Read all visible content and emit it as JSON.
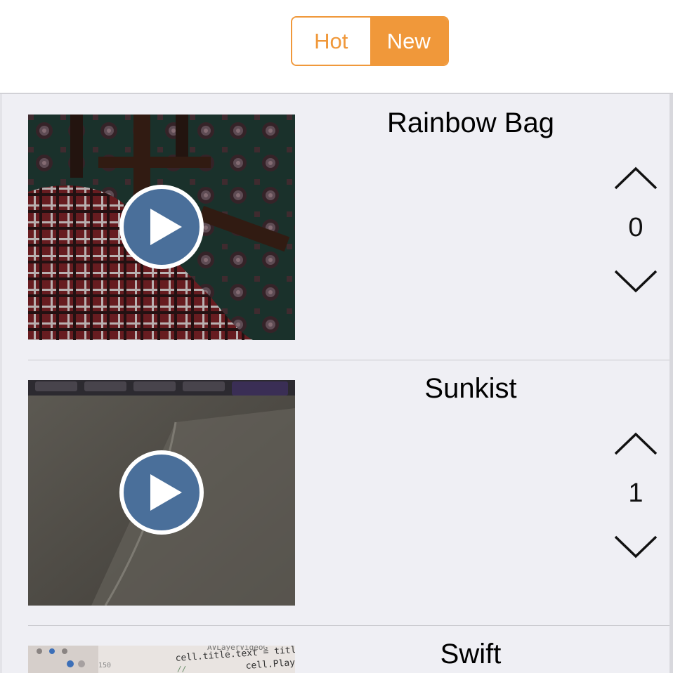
{
  "tabs": {
    "hot_label": "Hot",
    "new_label": "New",
    "selected": "New"
  },
  "posts": [
    {
      "title": "Rainbow Bag",
      "votes": "0",
      "thumbnail": "carpet-and-plaid-video-thumbnail"
    },
    {
      "title": "Sunkist",
      "votes": "1",
      "thumbnail": "trackpad-video-thumbnail"
    },
    {
      "title": "Swift",
      "votes": "",
      "thumbnail": "code-editor-video-thumbnail"
    }
  ],
  "code_preview": {
    "line_number": "150",
    "line1": "cell.title.text = title",
    "line2": "cell.Play",
    "comment": "//",
    "faded": "AVLayerVideoG"
  },
  "colors": {
    "accent": "#f0983a",
    "play_button": "#4a6f9a",
    "background": "#efeff4"
  }
}
